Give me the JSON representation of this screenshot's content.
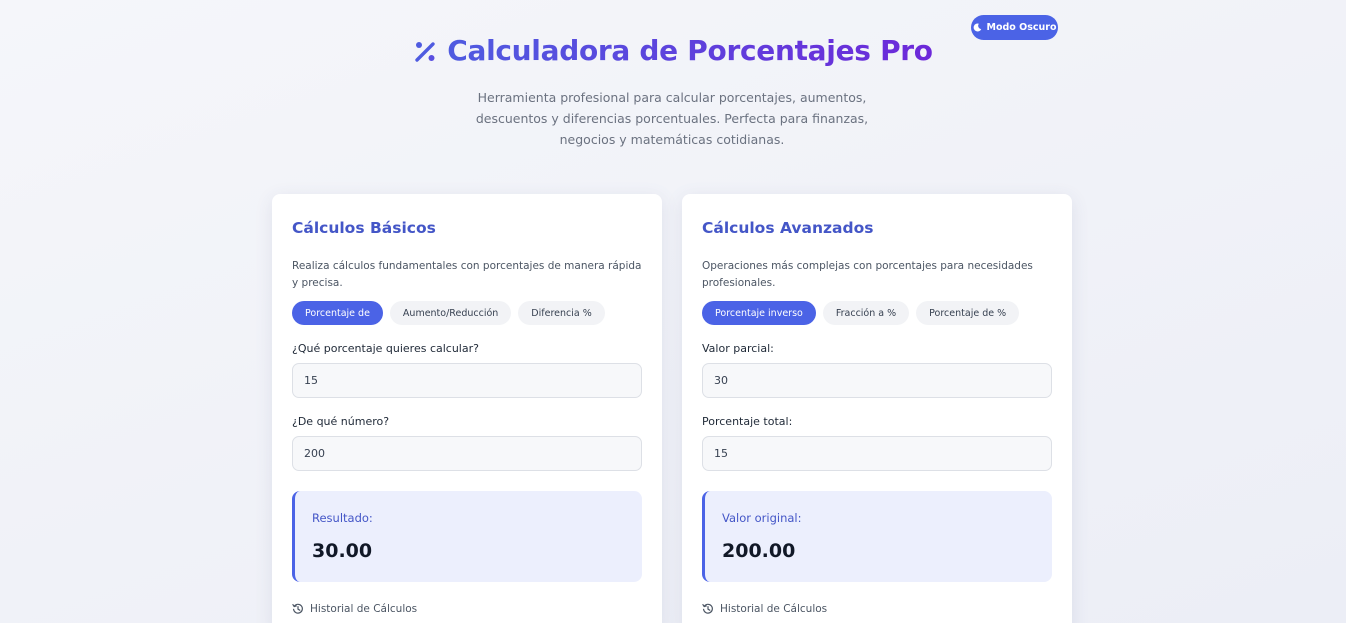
{
  "header": {
    "dark_mode_label": "Modo Oscuro",
    "title": "Calculadora de Porcentajes Pro",
    "subtitle": "Herramienta profesional para calcular porcentajes, aumentos, descuentos y diferencias porcentuales. Perfecta para finanzas, negocios y matemáticas cotidianas."
  },
  "colors": {
    "accent": "#4b63e6",
    "title_gradient_start": "#4f5be0",
    "title_gradient_end": "#6d28d9",
    "result_bg": "#eceffd"
  },
  "basic": {
    "title": "Cálculos Básicos",
    "description": "Realiza cálculos fundamentales con porcentajes de manera rápida y precisa.",
    "tabs": [
      {
        "label": "Porcentaje de",
        "active": true
      },
      {
        "label": "Aumento/Reducción",
        "active": false
      },
      {
        "label": "Diferencia %",
        "active": false
      }
    ],
    "field1_label": "¿Qué porcentaje quieres calcular?",
    "field1_value": "15",
    "field2_label": "¿De qué número?",
    "field2_value": "200",
    "result_label": "Resultado:",
    "result_value": "30.00",
    "history_label": "Historial de Cálculos"
  },
  "advanced": {
    "title": "Cálculos Avanzados",
    "description": "Operaciones más complejas con porcentajes para necesidades profesionales.",
    "tabs": [
      {
        "label": "Porcentaje inverso",
        "active": true
      },
      {
        "label": "Fracción a %",
        "active": false
      },
      {
        "label": "Porcentaje de %",
        "active": false
      }
    ],
    "field1_label": "Valor parcial:",
    "field1_value": "30",
    "field2_label": "Porcentaje total:",
    "field2_value": "15",
    "result_label": "Valor original:",
    "result_value": "200.00",
    "history_label": "Historial de Cálculos"
  },
  "icons": {
    "title": "percent-icon",
    "dark_mode": "moon-icon",
    "history": "history-icon"
  }
}
